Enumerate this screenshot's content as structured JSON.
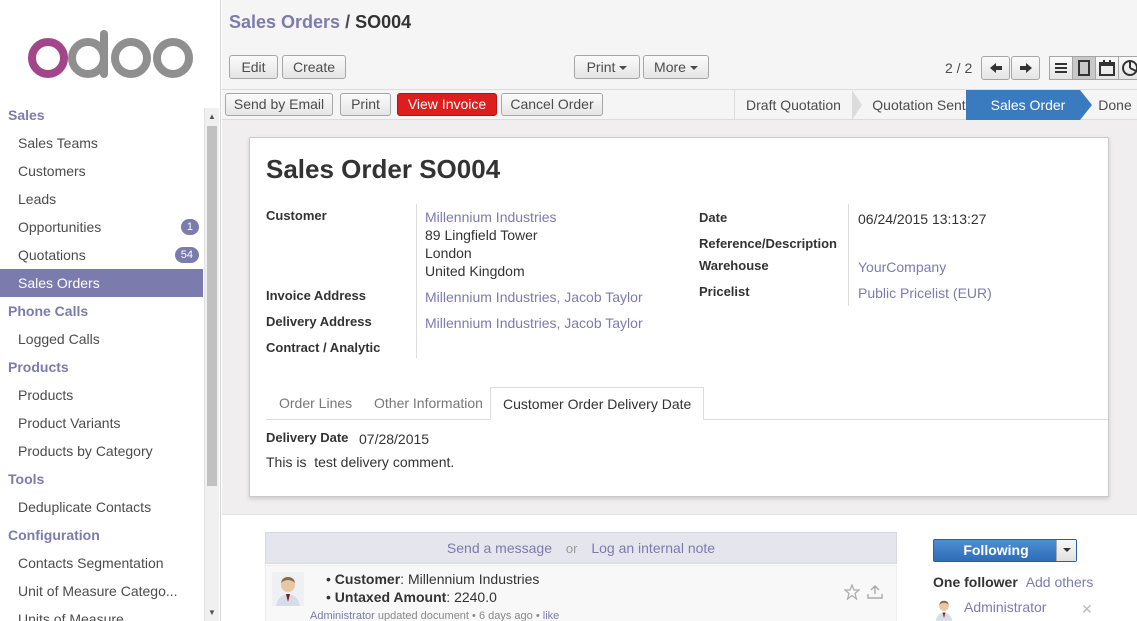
{
  "sidebar": {
    "logo": "odoo",
    "menu": [
      {
        "type": "section",
        "label": "Sales"
      },
      {
        "type": "item",
        "label": "Sales Teams"
      },
      {
        "type": "item",
        "label": "Customers"
      },
      {
        "type": "item",
        "label": "Leads"
      },
      {
        "type": "item",
        "label": "Opportunities",
        "badge": "1"
      },
      {
        "type": "item",
        "label": "Quotations",
        "badge": "54"
      },
      {
        "type": "item",
        "label": "Sales Orders",
        "active": true
      },
      {
        "type": "section",
        "label": "Phone Calls"
      },
      {
        "type": "item",
        "label": "Logged Calls"
      },
      {
        "type": "section",
        "label": "Products"
      },
      {
        "type": "item",
        "label": "Products"
      },
      {
        "type": "item",
        "label": "Product Variants"
      },
      {
        "type": "item",
        "label": "Products by Category"
      },
      {
        "type": "section",
        "label": "Tools"
      },
      {
        "type": "item",
        "label": "Deduplicate Contacts"
      },
      {
        "type": "section",
        "label": "Configuration"
      },
      {
        "type": "item",
        "label": "Contacts Segmentation"
      },
      {
        "type": "item",
        "label": "Unit of Measure Catego..."
      },
      {
        "type": "item",
        "label": "Units of Measure"
      }
    ]
  },
  "breadcrumb": {
    "parent": "Sales Orders",
    "separator": "/",
    "current": "SO004"
  },
  "toolbar": {
    "edit": "Edit",
    "create": "Create",
    "print": "Print",
    "more": "More",
    "pager": "2 / 2",
    "views": [
      "list-view-icon",
      "form-view-icon",
      "calendar-view-icon",
      "graph-view-icon"
    ]
  },
  "statusbar": {
    "buttons": [
      "Send by Email",
      "Print",
      "View Invoice",
      "Cancel Order"
    ],
    "stages": [
      "Draft Quotation",
      "Quotation Sent",
      "Sales Order",
      "Done"
    ],
    "active_stage": "Sales Order"
  },
  "form": {
    "title_prefix": "Sales Order",
    "title_number": "SO004",
    "customer_label": "Customer",
    "customer_name": "Millennium Industries",
    "customer_address": [
      "89 Lingfield Tower",
      "London",
      "United Kingdom"
    ],
    "invoice_address_label": "Invoice Address",
    "invoice_address": "Millennium Industries, Jacob Taylor",
    "delivery_address_label": "Delivery Address",
    "delivery_address": "Millennium Industries, Jacob Taylor",
    "contract_label": "Contract / Analytic",
    "date_label": "Date",
    "date": "06/24/2015 13:13:27",
    "reference_label": "Reference/Description",
    "warehouse_label": "Warehouse",
    "warehouse": "YourCompany",
    "pricelist_label": "Pricelist",
    "pricelist": "Public Pricelist (EUR)"
  },
  "tabs": [
    "Order Lines",
    "Other Information",
    "Customer Order Delivery Date"
  ],
  "active_tab": "Customer Order Delivery Date",
  "delivery": {
    "label": "Delivery Date",
    "date": "07/28/2015",
    "comment": "This is  test delivery comment."
  },
  "chatter": {
    "send_message": "Send a message",
    "or": "or",
    "log_note": "Log an internal note",
    "message_lines": [
      {
        "key": "Customer",
        "value": "Millennium Industries"
      },
      {
        "key": "Untaxed Amount",
        "value": "2240.0"
      }
    ],
    "author": "Administrator",
    "action": "updated document",
    "time": "6 days ago",
    "like": "like",
    "following": "Following",
    "followers_count": "One follower",
    "add_others": "Add others",
    "follower_name": "Administrator"
  },
  "colors": {
    "brand": "#7c7bad",
    "primary_button": "#dc1e1e",
    "active_stage": "#3a7bc0"
  }
}
